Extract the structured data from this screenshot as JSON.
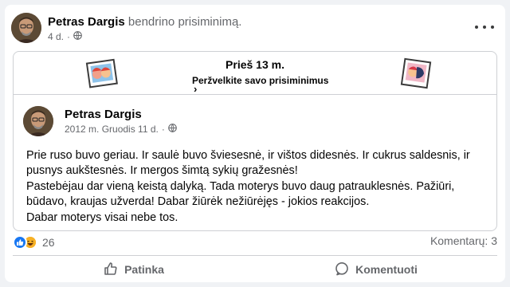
{
  "post": {
    "author": "Petras Dargis",
    "action": "bendrino prisiminimą.",
    "time": "4 d.",
    "audience_icon": "globe-icon",
    "more_icon": "ellipsis-icon"
  },
  "memory": {
    "title": "Prieš 13 m.",
    "subtitle": "Peržvelkite savo prisiminimus",
    "chevron": "›"
  },
  "original": {
    "author": "Petras Dargis",
    "date": "2012 m. Gruodis 11 d.",
    "audience_icon": "globe-icon",
    "lines": [
      "Prie ruso buvo geriau. Ir saulė buvo šviesesnė, ir vištos didesnės. Ir cukrus saldesnis, ir pusnys aukštesnės. Ir mergos šimtą sykių gražesnės!",
      "Pastebėjau dar vieną keistą dalyką. Tada moterys buvo daug patrauklesnės. Pažiūri, būdavo, kraujas užverda! Dabar žiūrėk nežiūrėjęs - jokios reakcijos.",
      "Dabar moterys visai nebe tos."
    ]
  },
  "reactions": {
    "count": "26",
    "types": [
      "like",
      "haha"
    ]
  },
  "comments_label": "Komentarų: 3",
  "actions": {
    "like": "Patinka",
    "comment": "Komentuoti"
  },
  "colors": {
    "like_blue": "#1877f2",
    "secondary_text": "#65676b",
    "border": "#ced0d4"
  }
}
